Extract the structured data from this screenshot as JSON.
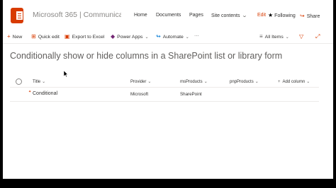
{
  "header": {
    "site_title": "Microsoft 365 | Communicati...",
    "nav": [
      {
        "label": "Home"
      },
      {
        "label": "Documents"
      },
      {
        "label": "Pages"
      },
      {
        "label": "Site contents"
      }
    ],
    "edit_label": "Edit",
    "following_label": "Following",
    "share_label": "Share"
  },
  "command_bar": {
    "new_label": "New",
    "quick_edit_label": "Quick edit",
    "export_label": "Export to Excel",
    "power_apps_label": "Power Apps",
    "automate_label": "Automate",
    "more_label": "···",
    "view_label": "All Items"
  },
  "page": {
    "title": "Conditionally show or hide columns in a SharePoint list or library form"
  },
  "list": {
    "columns": [
      "Title",
      "Provider",
      "msProducts",
      "pnpProducts",
      "Add column"
    ],
    "rows": [
      {
        "title": "Conditional",
        "provider": "Microsoft",
        "msProducts": "SharePoint",
        "pnpProducts": ""
      }
    ]
  },
  "icons": {
    "brand_color": "#d83b01",
    "accent_blue": "#0078d4"
  }
}
